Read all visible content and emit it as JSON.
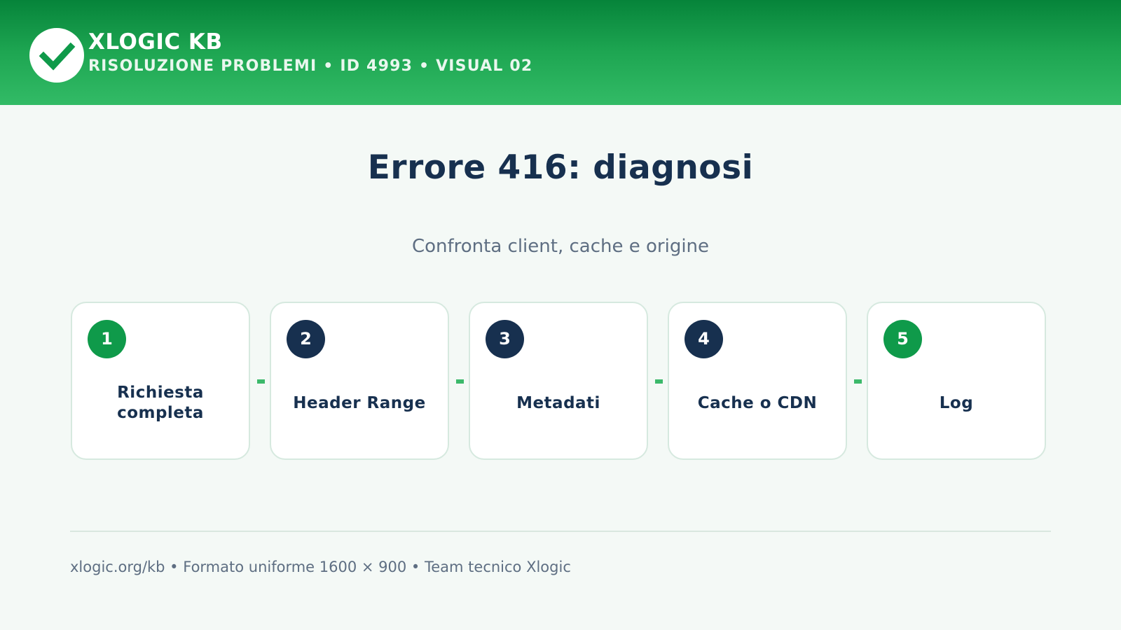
{
  "header": {
    "logo_icon": "check-icon",
    "brand": "XLOGIC KB",
    "subtitle": "RISOLUZIONE PROBLEMI • ID 4993 • VISUAL 02"
  },
  "main": {
    "title": "Errore 416: diagnosi",
    "subtitle": "Confronta client, cache e origine"
  },
  "steps": [
    {
      "number": "1",
      "label": "Richiesta completa",
      "badge_color": "#0f9a4a"
    },
    {
      "number": "2",
      "label": "Header Range",
      "badge_color": "#17304f"
    },
    {
      "number": "3",
      "label": "Metadati",
      "badge_color": "#17304f"
    },
    {
      "number": "4",
      "label": "Cache o CDN",
      "badge_color": "#17304f"
    },
    {
      "number": "5",
      "label": "Log",
      "badge_color": "#0f9a4a"
    }
  ],
  "footer": {
    "text": "xlogic.org/kb • Formato uniforme 1600 × 900 • Team tecnico Xlogic"
  },
  "colors": {
    "brand_green": "#0f9a4a",
    "navy": "#17304f",
    "connector": "#3cb96b"
  }
}
